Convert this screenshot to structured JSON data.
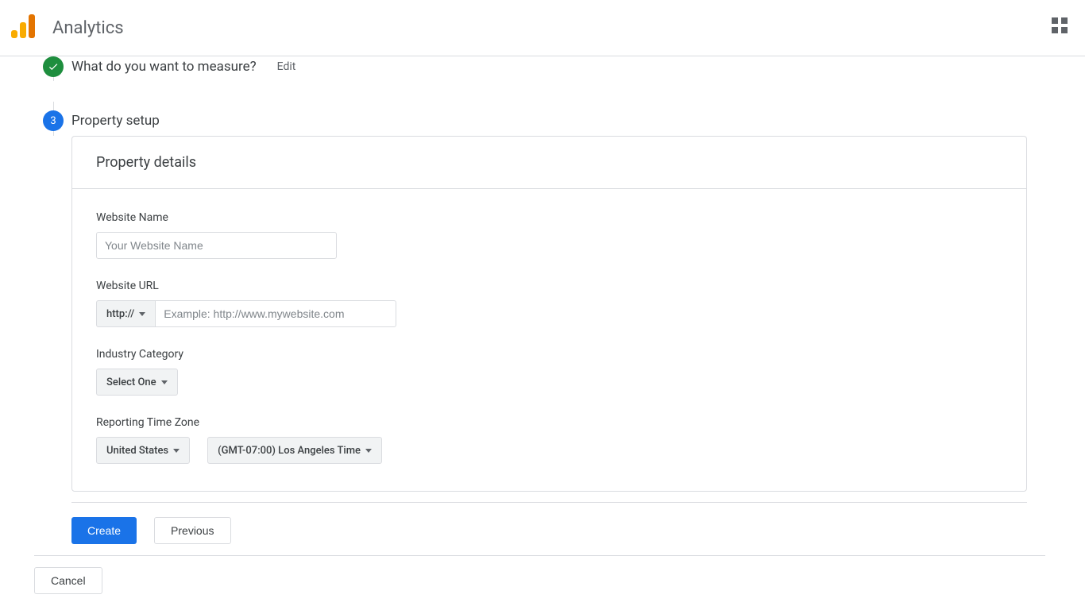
{
  "header": {
    "app_title": "Analytics"
  },
  "steps": {
    "step2": {
      "title": "What do you want to measure?",
      "edit_label": "Edit"
    },
    "step3": {
      "number": "3",
      "title": "Property setup"
    }
  },
  "card": {
    "title": "Property details",
    "website_name": {
      "label": "Website Name",
      "placeholder": "Your Website Name",
      "value": ""
    },
    "website_url": {
      "label": "Website URL",
      "protocol": "http://",
      "placeholder": "Example: http://www.mywebsite.com",
      "value": ""
    },
    "industry": {
      "label": "Industry Category",
      "selected": "Select One"
    },
    "timezone": {
      "label": "Reporting Time Zone",
      "country": "United States",
      "tz": "(GMT-07:00) Los Angeles Time"
    }
  },
  "actions": {
    "create": "Create",
    "previous": "Previous",
    "cancel": "Cancel"
  }
}
